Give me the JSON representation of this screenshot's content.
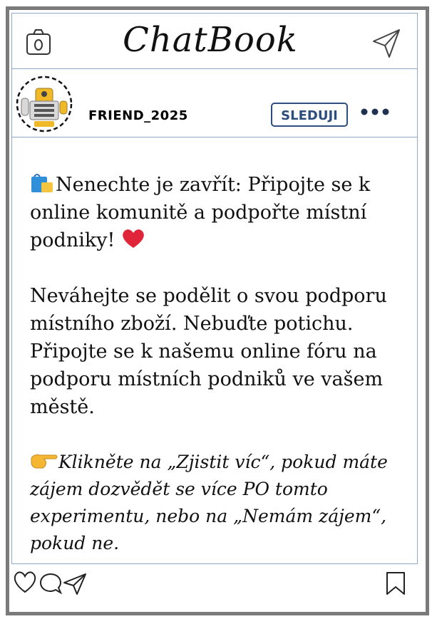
{
  "app": {
    "title": "ChatBook"
  },
  "header": {
    "camera_icon": "camera-icon",
    "send_icon": "paper-plane-icon"
  },
  "profile": {
    "username": "FRIEND_2025",
    "follow_label": "SLEDUJI",
    "more_icon": "more-dots-icon",
    "avatar_icon": "robot-avatar-icon"
  },
  "post": {
    "p1": "Nenechte je zavřít: Připojte se k online komunitě a podpořte místní podniky!",
    "p2": "Neváhejte se podělit o svou podporu místního zboží. Nebuďte potichu. Připojte se k našemu online fóru na podporu místních podniků ve vašem městě.",
    "p3": "Klikněte na „Zjistit víc“, pokud máte zájem dozvědět se více PO tomto experimentu, nebo na „Nemám zájem“, pokud ne.",
    "emoji_bag": "shopping-bags-icon",
    "emoji_heart": "red-heart-icon",
    "emoji_point": "pointing-hand-icon"
  },
  "actions": {
    "like_icon": "heart-icon",
    "comment_icon": "comment-icon",
    "share_icon": "share-icon",
    "bookmark_icon": "bookmark-icon"
  },
  "colors": {
    "frame": "#7a7a7a",
    "divider": "#8fa9c8",
    "follow": "#2d4d7c",
    "heart": "#e0243a"
  }
}
